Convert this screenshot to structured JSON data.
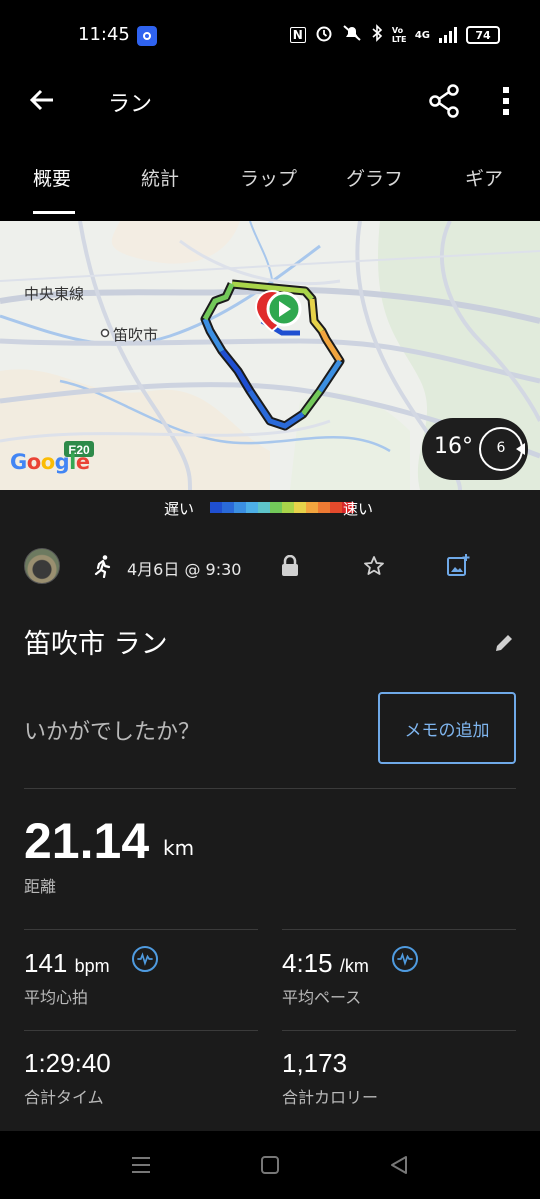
{
  "status_bar": {
    "time": "11:45",
    "battery": "74",
    "network": "4G",
    "volte": "Vo LTE",
    "nfc": "N"
  },
  "app_bar": {
    "title": "ラン"
  },
  "tabs": [
    {
      "label": "概要",
      "active": true
    },
    {
      "label": "統計",
      "active": false
    },
    {
      "label": "ラップ",
      "active": false
    },
    {
      "label": "グラフ",
      "active": false
    },
    {
      "label": "ギア",
      "active": false
    }
  ],
  "map": {
    "labels": {
      "line_name": "中央東線",
      "city": "笛吹市",
      "route_shield": "E20"
    },
    "attribution": "Google",
    "weather": {
      "temperature": "16°",
      "wind_speed": "6"
    }
  },
  "speed_legend": {
    "slow": "遅い",
    "fast": "速い",
    "colors": [
      "#1f4fd1",
      "#2a6ad9",
      "#3b8fe2",
      "#4dafe7",
      "#5ec4c9",
      "#73c95a",
      "#a9d44a",
      "#e6d24a",
      "#f2a53e",
      "#ee7a33",
      "#e34a2c",
      "#d8282a"
    ]
  },
  "activity": {
    "date": "4月6日 @ 9:30",
    "name": "笛吹市 ラン",
    "feeling_prompt": "いかがでしたか？",
    "memo_button": "メモの追加"
  },
  "stats": {
    "distance": {
      "value": "21.14",
      "unit": "km",
      "label": "距離"
    },
    "avg_hr": {
      "value": "141",
      "unit": "bpm",
      "label": "平均心拍"
    },
    "avg_pace": {
      "value": "4:15",
      "unit": "/km",
      "label": "平均ペース"
    },
    "total_time": {
      "value": "1:29:40",
      "label": "合計タイム"
    },
    "calories": {
      "value": "1,173",
      "label": "合計カロリー"
    }
  },
  "colors": {
    "accent_blue": "#6fa9e8",
    "background": "#1b1b1b",
    "start_marker": "#2fa84f"
  }
}
